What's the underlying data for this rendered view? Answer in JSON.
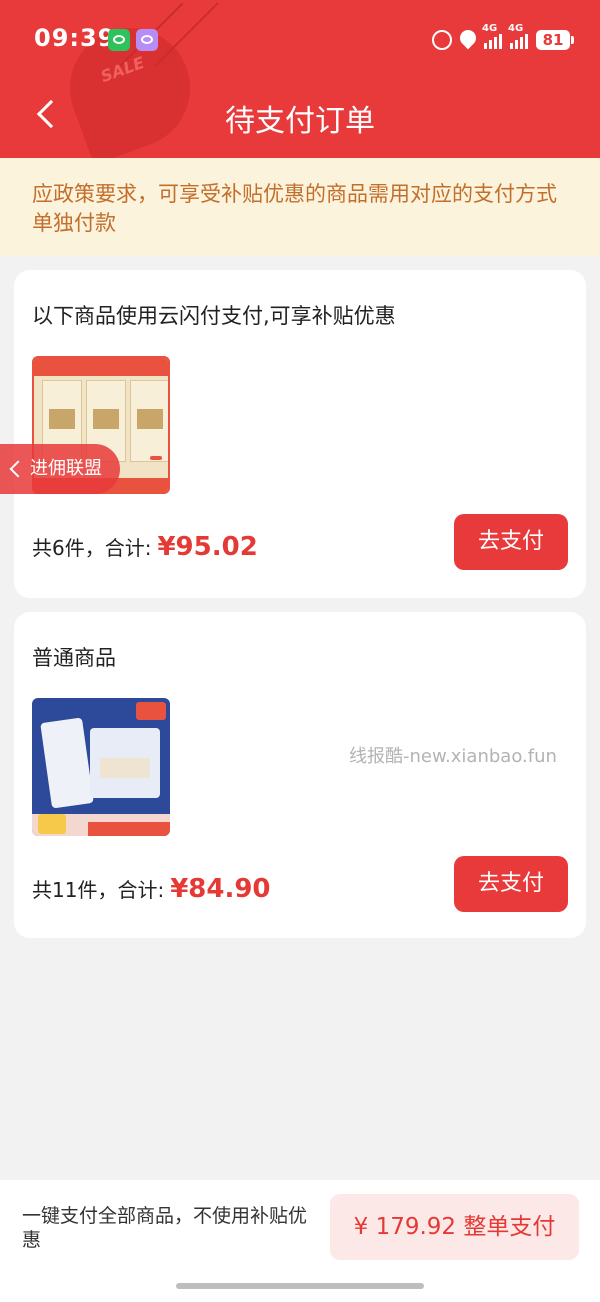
{
  "status_bar": {
    "time": "09:39",
    "battery": "81",
    "network": [
      "4G",
      "4G"
    ]
  },
  "header": {
    "title": "待支付订单",
    "deco_text": "SALE"
  },
  "notice": {
    "text": "应政策要求，可享受补贴优惠的商品需用对应的支付方式单独付款"
  },
  "orders": [
    {
      "title": "以下商品使用云闪付支付,可享补贴优惠",
      "summary_prefix": "共6件，合计:",
      "amount": "¥95.02",
      "pay_label": "去支付"
    },
    {
      "title": "普通商品",
      "summary_prefix": "共11件，合计:",
      "amount": "¥84.90",
      "pay_label": "去支付"
    }
  ],
  "float_tag": {
    "label": "进佣联盟"
  },
  "watermark": "线报酷-new.xianbao.fun",
  "bottom": {
    "text": "一键支付全部商品，不使用补贴优惠",
    "button": "¥ 179.92 整单支付"
  },
  "colors": {
    "brand_red": "#e83a3a",
    "notice_bg": "#fcf3dc",
    "notice_text": "#c36f2c",
    "price_red": "#e53935"
  },
  "icons": [
    "back-chevron-icon",
    "wechat-icon",
    "alarm-icon",
    "location-icon",
    "signal-icon",
    "battery-icon"
  ]
}
